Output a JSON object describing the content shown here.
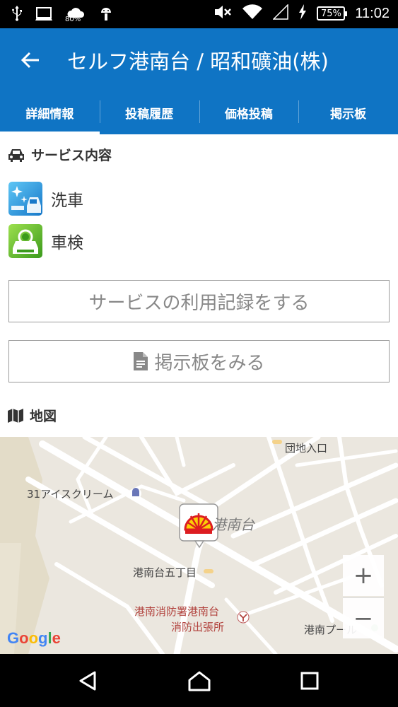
{
  "status_bar": {
    "battery_percent": "75%",
    "time": "11:02",
    "weather_percent": "80%"
  },
  "app_bar": {
    "title": "セルフ港南台 / 昭和礦油(株)"
  },
  "tabs": [
    {
      "label": "詳細情報",
      "active": true
    },
    {
      "label": "投稿履歴",
      "active": false
    },
    {
      "label": "価格投稿",
      "active": false
    },
    {
      "label": "掲示板",
      "active": false
    }
  ],
  "services": {
    "title": "サービス内容",
    "items": [
      {
        "label": "洗車",
        "icon": "car-wash-icon"
      },
      {
        "label": "車検",
        "icon": "car-inspection-icon"
      }
    ]
  },
  "buttons": {
    "record_usage": "サービスの利用記録をする",
    "view_board": "掲示板をみる"
  },
  "map": {
    "title": "地図",
    "labels": {
      "danchi": "団地入口",
      "icecream": "31アイスクリーム",
      "konandai": "港南台",
      "gochome": "港南台五丁目",
      "fire_station_1": "港南消防署港南台",
      "fire_station_2": "消防出張所",
      "pool": "港南プール"
    },
    "zoom_in": "+",
    "zoom_out": "−",
    "attribution": "Google"
  },
  "colors": {
    "primary": "#0f74c4",
    "map_background": "#ebe7df",
    "shell_red": "#dd1d21",
    "shell_yellow": "#fbce07"
  }
}
